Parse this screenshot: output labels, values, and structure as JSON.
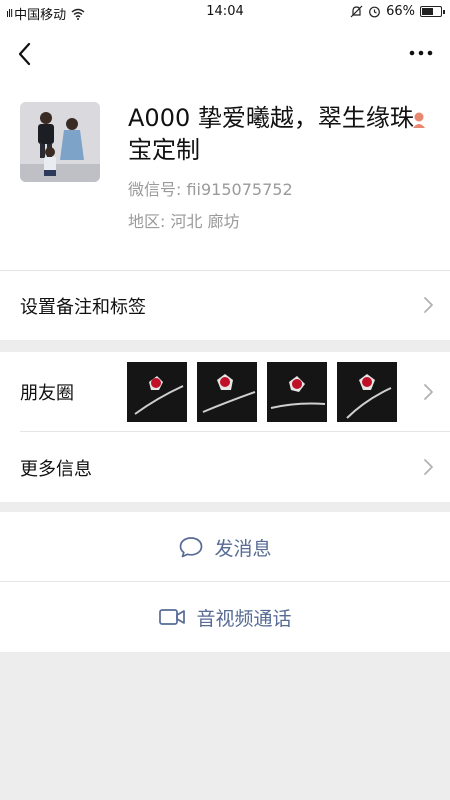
{
  "status_bar": {
    "carrier": "中国移动",
    "time": "14:04",
    "battery": "66%",
    "battery_level": 0.66
  },
  "profile": {
    "name": "A000 挚爱曦越，翠生缘珠宝定制",
    "wechat_id": "微信号: fii915075752",
    "region": "地区:  河北  廊坊"
  },
  "rows": {
    "remark_label": "设置备注和标签",
    "moments_label": "朋友圈",
    "more_info_label": "更多信息"
  },
  "actions": {
    "send_message": "发消息",
    "video_call": "音视频通话"
  },
  "icons": {
    "back": "back-arrow-icon",
    "more": "more-dots-icon",
    "chevron": "chevron-right-icon",
    "message": "chat-bubble-icon",
    "video": "video-camera-icon"
  },
  "colors": {
    "link_blue": "#576b95",
    "background": "#ededed"
  }
}
